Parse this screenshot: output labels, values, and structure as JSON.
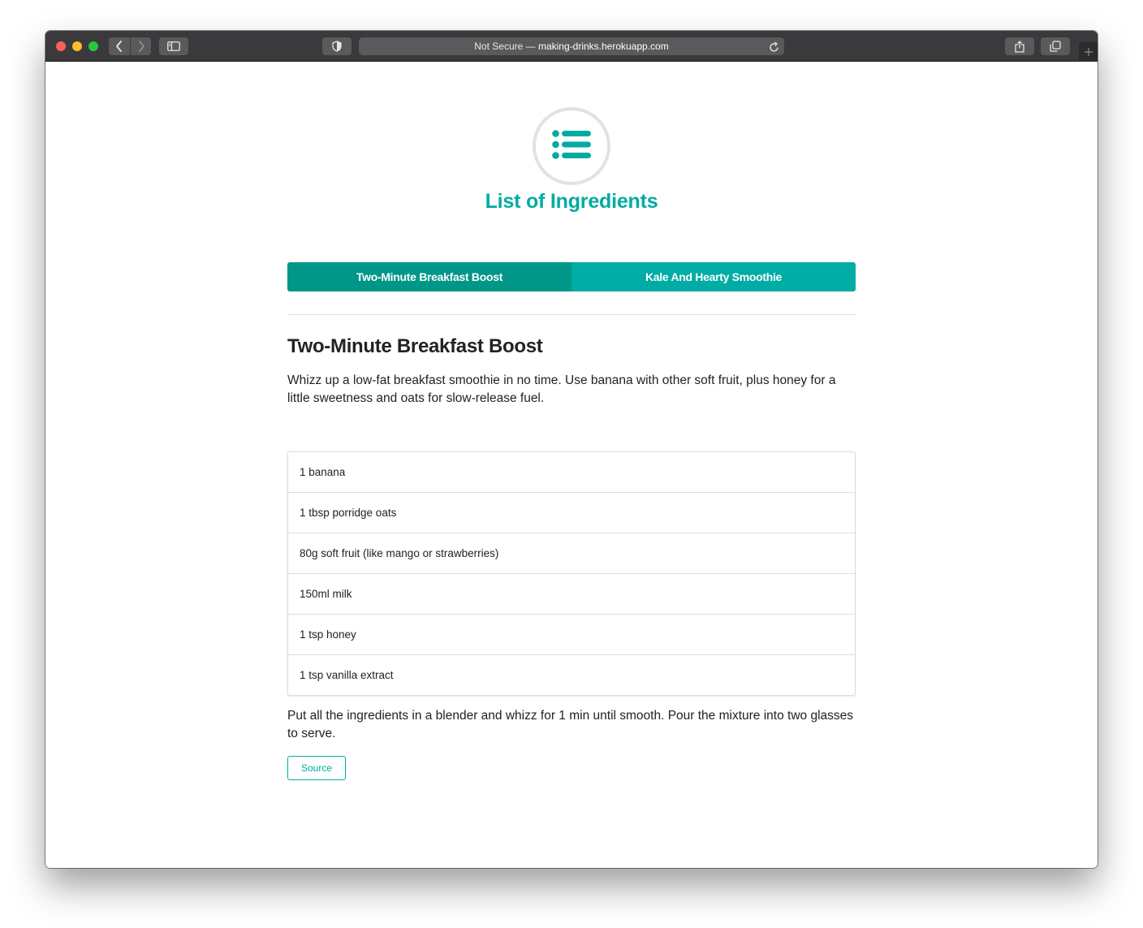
{
  "browser": {
    "address_prefix": "Not Secure — ",
    "address_host": "making-drinks.herokuapp.com",
    "icons": [
      "back-icon",
      "forward-icon",
      "sidebar-icon",
      "shield-icon",
      "reload-icon",
      "share-icon",
      "tabs-icon",
      "plus-icon"
    ]
  },
  "page": {
    "title": "List of Ingredients",
    "logo_icon": "list-icon",
    "accent_color": "#00aba1",
    "tabs": [
      {
        "label": "Two-Minute Breakfast Boost",
        "active": true
      },
      {
        "label": "Kale And Hearty Smoothie",
        "active": false
      }
    ],
    "recipe": {
      "title": "Two-Minute Breakfast Boost",
      "description": "Whizz up a low-fat breakfast smoothie in no time. Use banana with other soft fruit, plus honey for a little sweetness and oats for slow-release fuel.",
      "ingredients": [
        "1 banana",
        "1 tbsp porridge oats",
        "80g soft fruit (like mango or strawberries)",
        "150ml milk",
        "1 tsp honey",
        "1 tsp vanilla extract"
      ],
      "instructions": "Put all the ingredients in a blender and whizz for 1 min until smooth. Pour the mixture into two glasses to serve.",
      "source_label": "Source"
    }
  }
}
